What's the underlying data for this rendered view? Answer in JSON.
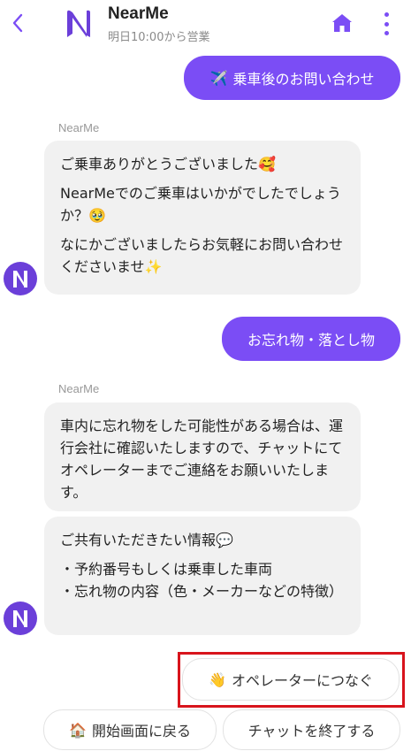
{
  "header": {
    "title": "NearMe",
    "status": "明日10:00から営業",
    "accent_color": "#7b4df5"
  },
  "messages": [
    {
      "type": "user",
      "icon": "✈️",
      "text": "乗車後のお問い合わせ"
    },
    {
      "type": "bot",
      "sender": "NearMe",
      "lines": [
        {
          "text": "ご乗車ありがとうございました",
          "emoji": "🥰"
        },
        {
          "text": "NearMeでのご乗車はいかがでしたでしょうか？",
          "emoji": "🥹"
        },
        {
          "text": "なにかございましたらお気軽にお問い合わせくださいませ",
          "emoji": "✨"
        }
      ]
    },
    {
      "type": "user",
      "text": "お忘れ物・落とし物"
    },
    {
      "type": "bot",
      "sender": "NearMe",
      "bubbles": [
        {
          "lines": [
            "車内に忘れ物をした可能性がある場合は、運行会社に確認いたしますので、チャットにてオペレーターまでご連絡をお願いいたします。"
          ]
        },
        {
          "title": "ご共有いただきたい情報",
          "title_emoji": "💬",
          "lines": [
            "・予約番号もしくは乗車した車両",
            "・忘れ物の内容（色・メーカーなどの特徴）"
          ]
        }
      ]
    }
  ],
  "actions": {
    "operator": {
      "icon": "👋",
      "label": "オペレーターにつなぐ"
    },
    "start": {
      "icon": "🏠",
      "label": "開始画面に戻る"
    },
    "end": {
      "label": "チャットを終了する"
    }
  }
}
